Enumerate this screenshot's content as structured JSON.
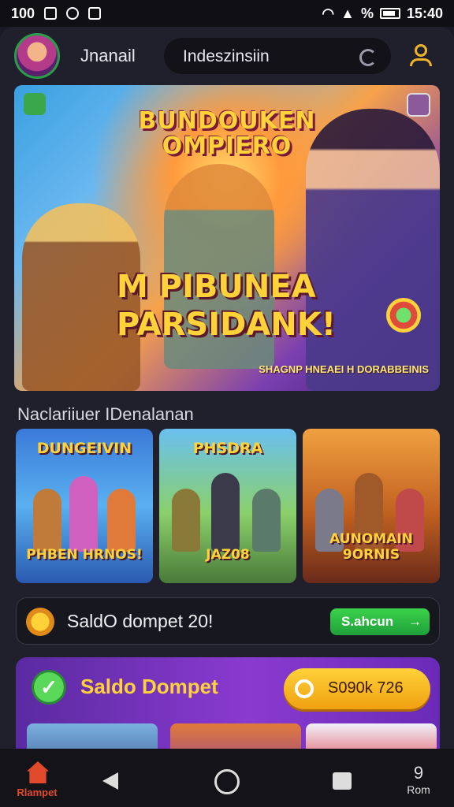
{
  "status_bar": {
    "left_text": "100",
    "percent": "%",
    "time": "15:40"
  },
  "top_nav": {
    "username": "Jnanail",
    "search_value": "Indeszinsiin",
    "icons": [
      "avatar",
      "refresh-icon",
      "profile-icon"
    ]
  },
  "hero": {
    "title": "BUNDOUKEN OMPIERO",
    "headline_line1": "M PIBUNEA",
    "headline_line2": "PARSIDANK!",
    "subtitle": "SHAGNP HNEAEI H DORABBEINIS"
  },
  "section": {
    "title": "Naclariiuer IDenalanan"
  },
  "game_cards": [
    {
      "title": "DUNGEIVIN",
      "caption": "PHBEN HRNOS!"
    },
    {
      "title": "PHSDRA",
      "caption": "JAZ08"
    },
    {
      "title": "",
      "caption": "AUNOMAIN 9ORNIS"
    }
  ],
  "wallet": {
    "text": "SaldO dompet  20!",
    "button_label": "S.ahcun",
    "button_arrow": "→"
  },
  "promo": {
    "title": "Saldo Dompet",
    "check_mark": "✓",
    "button_label": "S090k 726"
  },
  "bottom_nav": {
    "home_label": "Rlampet",
    "more_number": "9",
    "more_label": "Rom"
  },
  "colors": {
    "accent": "#ffd23a",
    "green": "#3ad24a",
    "purple": "#8a3ad0",
    "background": "#20202c"
  }
}
